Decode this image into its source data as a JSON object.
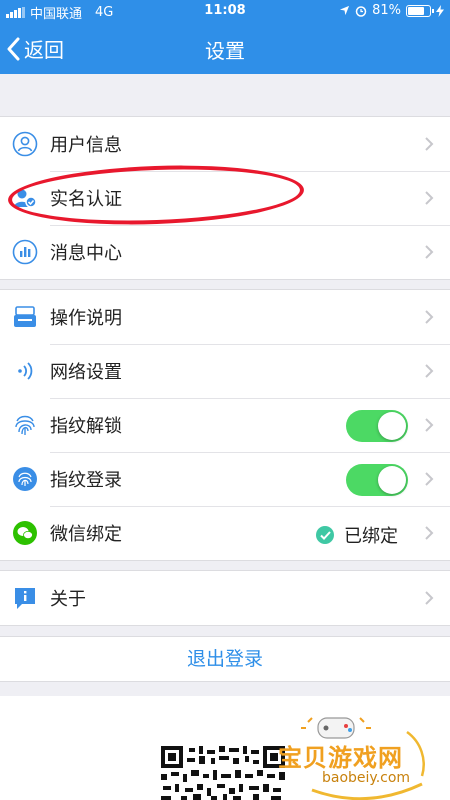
{
  "status_bar": {
    "carrier": "中国联通",
    "network": "4G",
    "time": "11:08",
    "battery": "81%",
    "battery_level": 0.81
  },
  "nav": {
    "back_label": "返回",
    "title": "设置"
  },
  "group1": [
    {
      "label": "用户信息",
      "icon": "user-icon"
    },
    {
      "label": "实名认证",
      "icon": "id-verify-icon"
    },
    {
      "label": "消息中心",
      "icon": "message-center-icon"
    }
  ],
  "group2": [
    {
      "label": "操作说明",
      "icon": "instructions-icon"
    },
    {
      "label": "网络设置",
      "icon": "network-icon"
    },
    {
      "label": "指纹解锁",
      "icon": "fingerprint-icon",
      "toggle": true
    },
    {
      "label": "指纹登录",
      "icon": "fingerprint-login-icon",
      "toggle": true
    },
    {
      "label": "微信绑定",
      "icon": "wechat-icon",
      "status": "已绑定"
    }
  ],
  "group3": [
    {
      "label": "关于",
      "icon": "info-icon"
    }
  ],
  "logout_label": "退出登录",
  "watermark": {
    "title": "宝贝游戏网",
    "url": "baobeiy.com"
  },
  "colors": {
    "nav_blue": "#2f8fe8",
    "toggle_green": "#4cd964",
    "highlight_red": "#e8182d"
  }
}
